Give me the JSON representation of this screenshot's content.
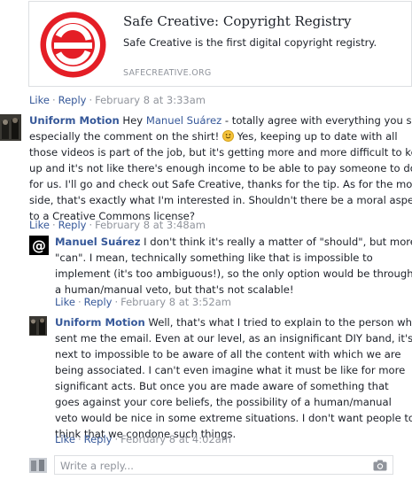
{
  "link_card": {
    "title": "Safe Creative: Copyright Registry",
    "description": "Safe Creative is the first digital copyright registry.",
    "domain": "SAFECREATIVE.ORG",
    "logo_icon": "safe-creative-logo",
    "logo_color": "#e41e26"
  },
  "actions_labels": {
    "like": "Like",
    "reply": "Reply",
    "separator": "·"
  },
  "post_actions": {
    "timestamp": "February 8 at 3:33am"
  },
  "comments": [
    {
      "author": "Uniform Motion",
      "lines": [
        {
          "pre": "Hey ",
          "mention": "Manuel Suárez",
          "post": " - totally agree with everything you say,"
        },
        {
          "text_before_emoji": "especially the comment on the shirt! ",
          "text_after_emoji": " Yes, keeping up to date with all"
        },
        {
          "text": "those videos is part of the job, but it's getting more and more difficult to keep"
        },
        {
          "text": "up and it's not like there's enough income to be able to pay someone to do it"
        },
        {
          "text": "for us. I'll go and check out Safe Creative, thanks for the tip. As for the moral"
        },
        {
          "text": "side, that's exactly what I'm interested in. Shouldn't there be a moral aspect"
        },
        {
          "text": "to a Creative Commons license?"
        }
      ],
      "timestamp": "February 8 at 3:48am",
      "emoji_icon": "smiley-emoji-icon"
    },
    {
      "author": "Manuel Suárez",
      "lines": [
        {
          "text": " I don't think it's really a matter of \"should\", but more of"
        },
        {
          "text": "\"can\". I mean, technically something like that is impossible to"
        },
        {
          "text": "implement (it's too ambiguous!), so the only option would be through"
        },
        {
          "text": "a human/manual veto, but that's not scalable!"
        }
      ],
      "timestamp": "February 8 at 3:52am"
    },
    {
      "author": "Uniform Motion",
      "lines": [
        {
          "text": " Well, that's what I tried to explain to the person who"
        },
        {
          "text": "sent me the email. Even at our level, as an insignificant DIY band, it's"
        },
        {
          "text": "next to impossible to be aware of all the content with which we are"
        },
        {
          "text": "being associated. I can't even imagine what it must be like for more"
        },
        {
          "text": "significant acts. But once you are made aware of something that"
        },
        {
          "text": "goes against your core beliefs, the possibility of a human/manual"
        },
        {
          "text": "veto would be nice in some extreme situations. I don't want people to"
        },
        {
          "text": "think that we condone such things."
        }
      ],
      "timestamp": "February 8 at 4:02am"
    }
  ],
  "reply_box": {
    "placeholder": "Write a reply...",
    "camera_icon": "camera-icon"
  }
}
